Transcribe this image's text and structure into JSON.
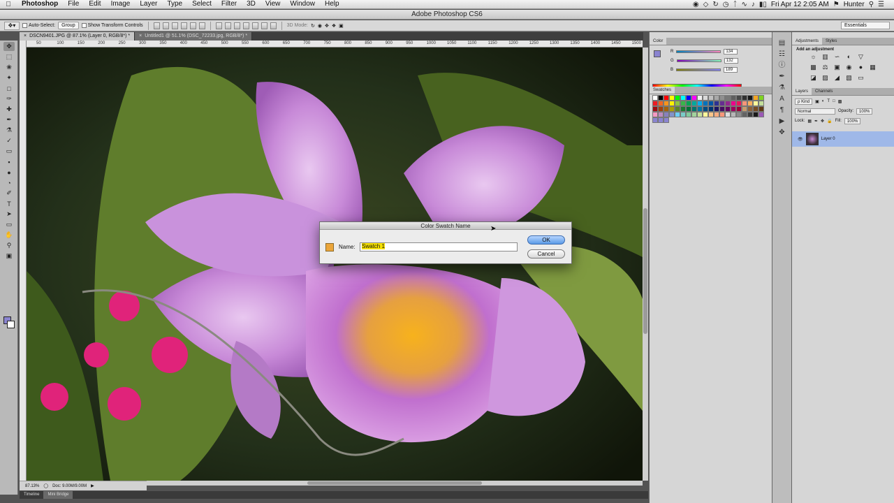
{
  "menubar": {
    "app_name": "Photoshop",
    "items": [
      "File",
      "Edit",
      "Image",
      "Layer",
      "Type",
      "Select",
      "Filter",
      "3D",
      "View",
      "Window",
      "Help"
    ],
    "clock": "Fri Apr 12  2:05 AM",
    "user": "Hunter"
  },
  "window": {
    "title": "Adobe Photoshop CS6"
  },
  "options": {
    "auto_select_label": "Auto-Select:",
    "auto_select_value": "Group",
    "transform_label": "Show Transform Controls",
    "mode_label": "3D Mode:",
    "workspace": "Essentials"
  },
  "documents": [
    {
      "label": "DSCN9401.JPG @ 87.1% (Layer 0, RGB/8*) *",
      "active": true
    },
    {
      "label": "Untitled1 @ 51.1% (DSC_72233.jpg, RGB/8*) *",
      "active": false
    }
  ],
  "ruler": {
    "ticks": [
      "50",
      "100",
      "150",
      "200",
      "250",
      "300",
      "350",
      "400",
      "450",
      "500",
      "550",
      "600",
      "650",
      "700",
      "750",
      "800",
      "850",
      "900",
      "950",
      "1000",
      "1050",
      "1100",
      "1150",
      "1200",
      "1250",
      "1300",
      "1350",
      "1400",
      "1450",
      "1500"
    ]
  },
  "status": {
    "zoom": "87.13%",
    "doc": "Doc: 9.00M/9.00M"
  },
  "bottom_tabs": [
    "Timeline",
    "Mini Bridge"
  ],
  "color_panel": {
    "tab": "Color",
    "r_label": "R",
    "r_value": "134",
    "g_label": "G",
    "g_value": "132",
    "b_label": "B",
    "b_value": "189",
    "fg_color": "#8a84d0"
  },
  "swatches_panel": {
    "tab": "Swatches",
    "colors": [
      "#ffffff",
      "#000000",
      "#ff0000",
      "#ffff00",
      "#00ff00",
      "#00ffff",
      "#0000ff",
      "#ff00ff",
      "#f0f0f0",
      "#d8d8d8",
      "#c0c0c0",
      "#a8a8a8",
      "#909090",
      "#787878",
      "#606060",
      "#484848",
      "#303030",
      "#181818",
      "#f5a623",
      "#7ed321",
      "#ed1c24",
      "#f26522",
      "#f7941d",
      "#fff200",
      "#8dc63f",
      "#39b54a",
      "#00a651",
      "#00a99d",
      "#00aeef",
      "#0072bc",
      "#0054a6",
      "#2e3192",
      "#662d91",
      "#92278f",
      "#ec008c",
      "#ed145b",
      "#f69679",
      "#fbaf5d",
      "#fff799",
      "#c4df9b",
      "#9e0b0f",
      "#a0410d",
      "#a3620a",
      "#aba000",
      "#598527",
      "#1a7b30",
      "#007236",
      "#00746b",
      "#0076a3",
      "#004b80",
      "#003471",
      "#1b1464",
      "#440e62",
      "#630460",
      "#9e005d",
      "#9e0039",
      "#c69c6d",
      "#8c6239",
      "#754c24",
      "#603913",
      "#f49ac2",
      "#bd8cbf",
      "#8781bd",
      "#8393ca",
      "#6dcff6",
      "#7accc8",
      "#82ca9c",
      "#a3d39c",
      "#c4df9b",
      "#fff79a",
      "#fdc68a",
      "#f9ad81",
      "#f7977a",
      "#dedede",
      "#b7b7b7",
      "#8c8c8c",
      "#636363",
      "#3d3d3d",
      "#1a1a1a",
      "#9b59b6",
      "#8a84d0",
      "#8a84d0",
      "#8a84d0"
    ]
  },
  "adjustments_panel": {
    "tabs": [
      "Adjustments",
      "Styles"
    ],
    "header": "Add an adjustment"
  },
  "layers_panel": {
    "tabs": [
      "Layers",
      "Channels"
    ],
    "kind": "ρ Kind",
    "blend_mode": "Normal",
    "opacity_label": "Opacity:",
    "opacity_value": "100%",
    "lock_label": "Lock:",
    "fill_label": "Fill:",
    "fill_value": "100%",
    "layer_name": "Layer 0"
  },
  "dialog": {
    "title": "Color Swatch Name",
    "name_label": "Name:",
    "name_value": "Swatch 1",
    "swatch_color": "#eba53a",
    "ok_label": "OK",
    "cancel_label": "Cancel"
  }
}
